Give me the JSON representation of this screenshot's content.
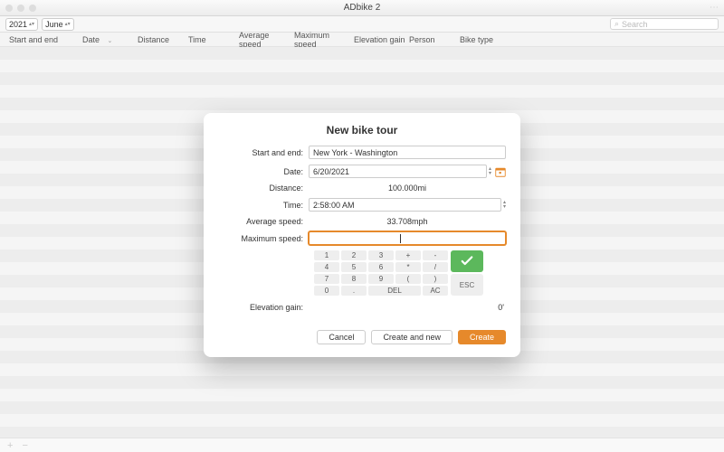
{
  "window": {
    "title": "ADbike 2"
  },
  "toolbar": {
    "year": "2021",
    "month": "June",
    "search_placeholder": "Search"
  },
  "columns": [
    "Start and end",
    "Date",
    "Distance",
    "Time",
    "Average speed",
    "Maximum speed",
    "Elevation gain",
    "Person",
    "Bike type"
  ],
  "dialog": {
    "title": "New bike tour",
    "labels": {
      "start_end": "Start and end:",
      "date": "Date:",
      "distance": "Distance:",
      "time": "Time:",
      "avg_speed": "Average speed:",
      "max_speed": "Maximum speed:",
      "elev_gain": "Elevation gain:"
    },
    "values": {
      "start_end": "New York - Washington",
      "date": "6/20/2021",
      "distance": "100.000mi",
      "time": "2:58:00 AM",
      "avg_speed": "33.708mph",
      "max_speed": "",
      "elev_gain": "0'"
    },
    "keypad": {
      "k1": "1",
      "k2": "2",
      "k3": "3",
      "kplus": "+",
      "kminus": "-",
      "k4": "4",
      "k5": "5",
      "k6": "6",
      "kmul": "*",
      "kdiv": "/",
      "k7": "7",
      "k8": "8",
      "k9": "9",
      "klp": "(",
      "krp": ")",
      "k0": "0",
      "kdot": ".",
      "kdel": "DEL",
      "kac": "AC",
      "esc": "ESC"
    },
    "buttons": {
      "cancel": "Cancel",
      "create_new": "Create and new",
      "create": "Create"
    }
  }
}
